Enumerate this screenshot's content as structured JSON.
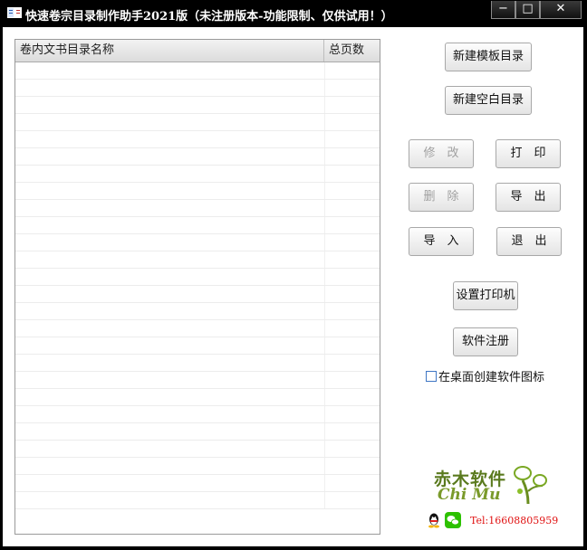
{
  "window": {
    "title": "快速卷宗目录制作助手2021版（未注册版本-功能限制、仅供试用！）",
    "min_glyph": "−",
    "max_glyph": "□",
    "close_glyph": "✕"
  },
  "list": {
    "col_name": "卷内文书目录名称",
    "col_pages": "总页数",
    "row_count": 26,
    "rows": []
  },
  "buttons": {
    "new_template": "新建模板目录",
    "new_blank": "新建空白目录",
    "edit": "修　改",
    "print": "打　印",
    "delete": "删　除",
    "export": "导　出",
    "import": "导　入",
    "exit": "退　出",
    "setup_printer": "设置打印机",
    "register": "软件注册"
  },
  "options": {
    "desktop_icon_label": "在桌面创建软件图标",
    "desktop_icon_checked": false
  },
  "branding": {
    "logo_cn": "赤木软件",
    "logo_py": "Chi Mu",
    "tel": "Tel:16608805959"
  },
  "colors": {
    "tel": "#e01010",
    "logo": "#5a7a1e",
    "checkbox_border": "#3f76c4"
  }
}
